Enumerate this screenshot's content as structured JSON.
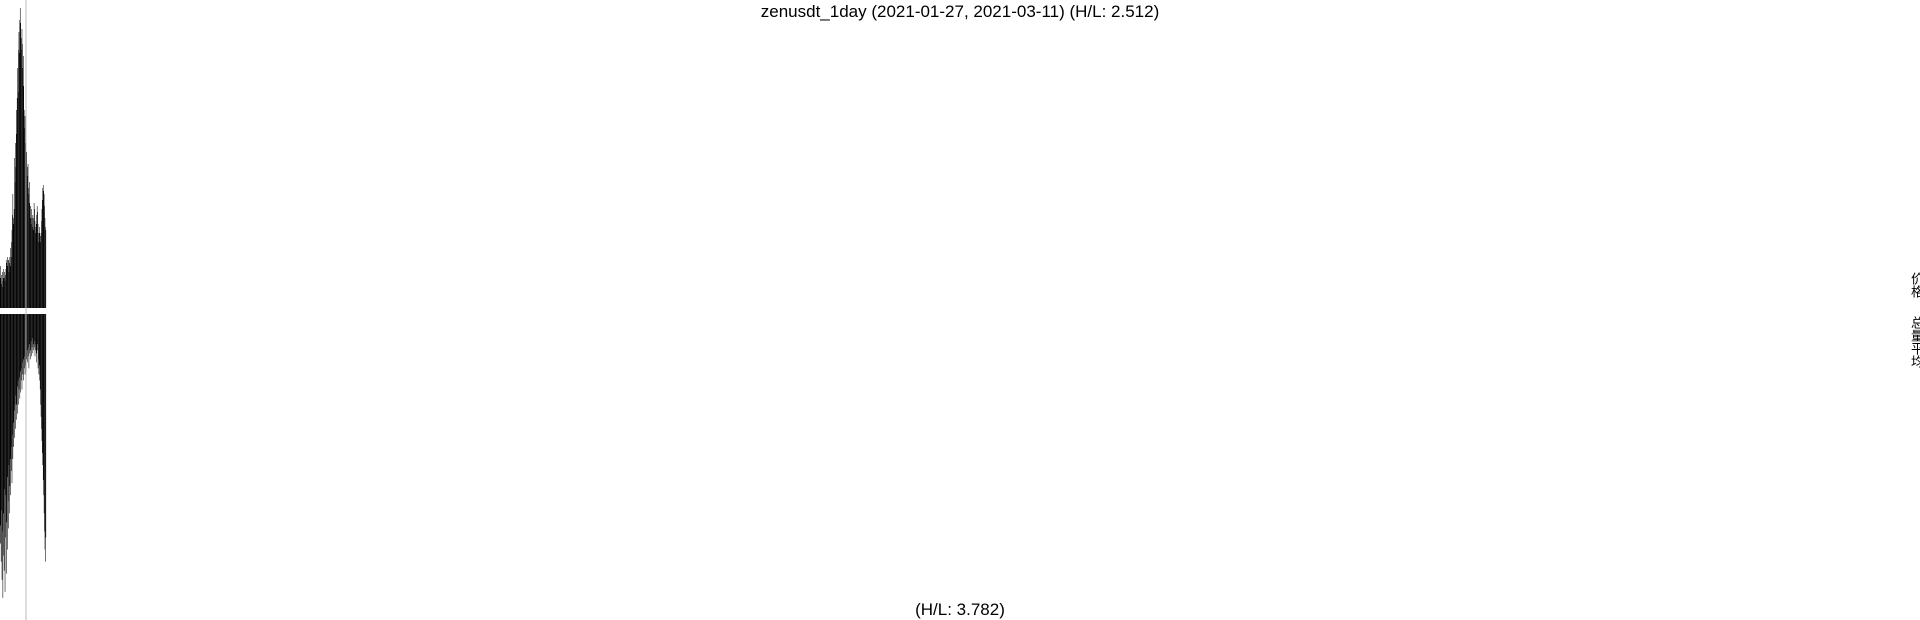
{
  "header": {
    "title": "zenusdt_1day (2021-01-27, 2021-03-11) (H/L: 2.512)"
  },
  "footer": {
    "subtitle": "(H/L: 3.782)"
  },
  "legend": {
    "price_label": "价格",
    "avg_label": "总量平均"
  },
  "chart_data": [
    {
      "type": "bar",
      "title": "zenusdt_1day (2021-01-27, 2021-03-11) (H/L: 2.512)",
      "x_range": [
        "2021-01-27",
        "2021-03-11"
      ],
      "grid": false,
      "bar_color": "#000000",
      "baseline": "bottom",
      "values": [
        0.14,
        0.1,
        0.08,
        0.11,
        0.09,
        0.12,
        0.07,
        0.1,
        0.13,
        0.1,
        0.12,
        0.09,
        0.11,
        0.13,
        0.15,
        0.16,
        0.14,
        0.17,
        0.16,
        0.16,
        0.12,
        0.15,
        0.17,
        0.14,
        0.2,
        0.17,
        0.22,
        0.26,
        0.31,
        0.38,
        0.3,
        0.28,
        0.33,
        0.5,
        0.42,
        0.55,
        0.47,
        0.66,
        0.58,
        0.7,
        0.8,
        0.72,
        0.86,
        0.92,
        0.85,
        0.96,
        1.0,
        0.95,
        0.9,
        0.86,
        0.93,
        0.88,
        0.8,
        0.84,
        0.74,
        0.66,
        0.6,
        0.64,
        0.55,
        0.58,
        0.5,
        0.52,
        0.47,
        0.44,
        0.48,
        0.4,
        0.38,
        0.42,
        0.35,
        0.3,
        0.34,
        0.28,
        0.33,
        0.3,
        0.27,
        0.31,
        0.26,
        0.3,
        0.35,
        0.33,
        0.29,
        0.27,
        0.25,
        0.28,
        0.31,
        0.34,
        0.32,
        0.28,
        0.25,
        0.22,
        0.25,
        0.27,
        0.24,
        0.22,
        0.25,
        0.29,
        0.33,
        0.36,
        0.4,
        0.41,
        0.39,
        0.38,
        0.34,
        0.3,
        0.27,
        0.26
      ]
    },
    {
      "type": "bar",
      "title": "(H/L: 3.782)",
      "x_range": [
        "2021-01-27",
        "2021-03-11"
      ],
      "grid": false,
      "bar_color": "#000000",
      "baseline": "top",
      "values": [
        0.76,
        0.7,
        0.82,
        0.65,
        0.88,
        0.72,
        0.94,
        0.8,
        0.66,
        0.85,
        0.58,
        0.92,
        0.74,
        0.6,
        0.86,
        0.69,
        0.54,
        0.78,
        0.62,
        0.71,
        0.5,
        0.66,
        0.57,
        0.48,
        0.6,
        0.52,
        0.44,
        0.56,
        0.4,
        0.48,
        0.36,
        0.44,
        0.32,
        0.41,
        0.3,
        0.38,
        0.27,
        0.35,
        0.3,
        0.24,
        0.33,
        0.22,
        0.3,
        0.25,
        0.21,
        0.28,
        0.19,
        0.26,
        0.22,
        0.18,
        0.25,
        0.16,
        0.2,
        0.15,
        0.22,
        0.18,
        0.14,
        0.2,
        0.17,
        0.13,
        0.19,
        0.15,
        0.12,
        0.16,
        0.14,
        0.11,
        0.18,
        0.13,
        0.1,
        0.15,
        0.12,
        0.09,
        0.14,
        0.11,
        0.08,
        0.13,
        0.1,
        0.12,
        0.09,
        0.11,
        0.14,
        0.1,
        0.12,
        0.16,
        0.13,
        0.1,
        0.12,
        0.18,
        0.15,
        0.2,
        0.17,
        0.22,
        0.25,
        0.3,
        0.34,
        0.38,
        0.42,
        0.46,
        0.5,
        0.55,
        0.6,
        0.66,
        0.72,
        0.78,
        0.82,
        0.74
      ]
    }
  ]
}
